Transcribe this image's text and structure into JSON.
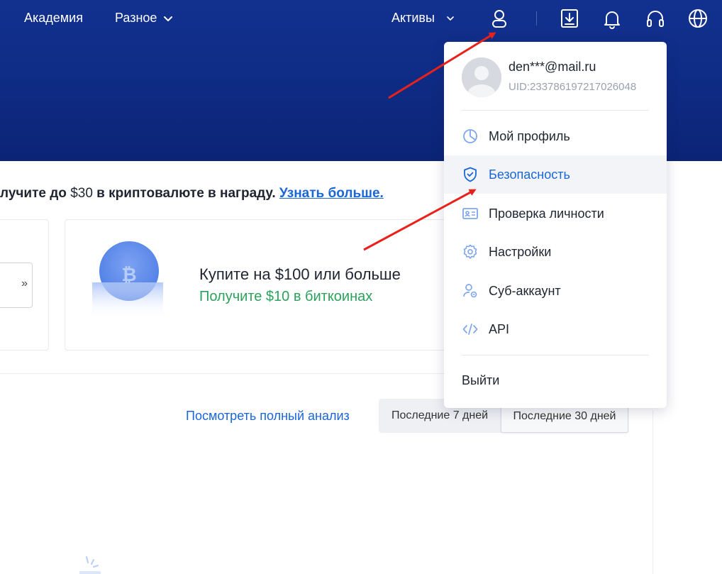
{
  "nav": {
    "academy": "Академия",
    "misc": "Разное",
    "assets": "Активы"
  },
  "promo": {
    "text_before": "лучите до ",
    "amount": "$30",
    "text_after": " в криптовалюте в награду. ",
    "link": "Узнать больше."
  },
  "card": {
    "title": "Купите на $100 или больше",
    "subtitle": "Получите $10 в биткоинах",
    "left_btn_glyph": "»"
  },
  "analysis": {
    "link": "Посмотреть полный анализ",
    "range_7": "Последние 7 дней",
    "range_30": "Последние 30 дней",
    "selected": "Последние 30 дней"
  },
  "account_menu": {
    "email": "den***@mail.ru",
    "uid": "UID:233786197217026048",
    "items": [
      {
        "label": "Мой профиль",
        "icon": "pie-chart-icon"
      },
      {
        "label": "Безопасность",
        "icon": "shield-check-icon",
        "active": true
      },
      {
        "label": "Проверка личности",
        "icon": "id-card-icon"
      },
      {
        "label": "Настройки",
        "icon": "gear-icon"
      },
      {
        "label": "Суб-аккаунт",
        "icon": "sub-account-icon"
      },
      {
        "label": "API",
        "icon": "code-icon"
      }
    ],
    "logout": "Выйти"
  },
  "colors": {
    "header_bg": "#0f2c86",
    "link_blue": "#1a66d6",
    "green": "#2aa35a",
    "icon_blue": "#7ea6ee",
    "annotation_red": "#e8221b"
  }
}
